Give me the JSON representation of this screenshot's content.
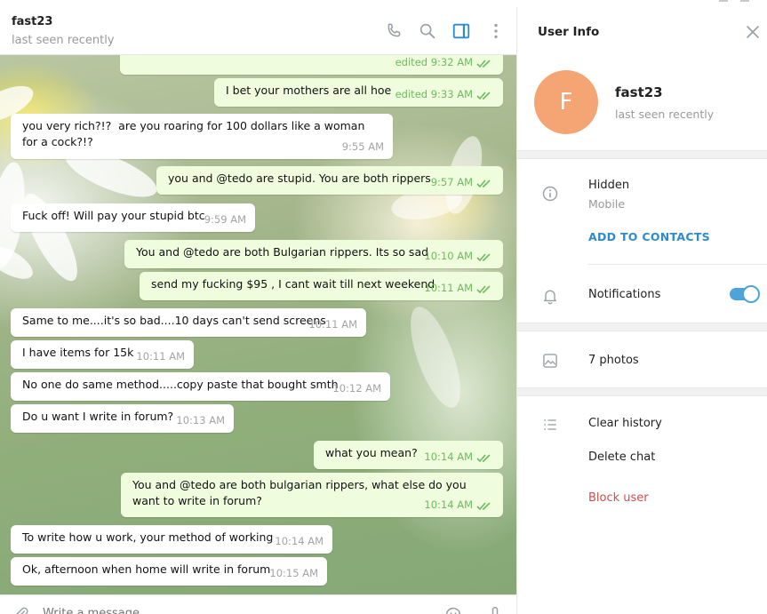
{
  "chat": {
    "title": "fast23",
    "subtitle": "last seen recently",
    "composer_placeholder": "Write a message...",
    "messages": [
      {
        "dir": "out",
        "text": "",
        "time": "edited 9:32 AM"
      },
      {
        "dir": "out",
        "text": "I bet your mothers are all hoe",
        "time": "edited 9:33 AM"
      },
      {
        "dir": "in",
        "text": "you very rich?!?  are you roaring for 100 dollars like a woman for a cock?!?",
        "time": "9:55 AM"
      },
      {
        "dir": "out",
        "text": "you and @tedo are stupid. You are both rippers",
        "time": "9:57 AM"
      },
      {
        "dir": "in",
        "text": "Fuck off! Will pay your stupid btc",
        "time": "9:59 AM"
      },
      {
        "dir": "out",
        "text": "You and @tedo are both Bulgarian rippers. Its so sad",
        "time": "10:10 AM"
      },
      {
        "dir": "out",
        "text": "send my fucking $95 , I cant wait till next weekend",
        "time": "10:11 AM"
      },
      {
        "dir": "in",
        "text": "Same to me....it's so bad....10 days can't send screens",
        "time": "10:11 AM"
      },
      {
        "dir": "in",
        "text": "I have items for 15k",
        "time": "10:11 AM"
      },
      {
        "dir": "in",
        "text": "No one do same method.....copy paste that bought smth",
        "time": "10:12 AM"
      },
      {
        "dir": "in",
        "text": "Do u want I write in forum?",
        "time": "10:13 AM"
      },
      {
        "dir": "out",
        "text": "what you mean?",
        "time": "10:14 AM"
      },
      {
        "dir": "out",
        "text": "You and @tedo are both bulgarian rippers, what else do you want to write in forum?",
        "time": "10:14 AM"
      },
      {
        "dir": "in",
        "text": "To write how u work, your method of working",
        "time": "10:14 AM"
      },
      {
        "dir": "in",
        "text": "Ok, afternoon when home will write in forum",
        "time": "10:15 AM"
      }
    ]
  },
  "info": {
    "title": "User Info",
    "avatar_letter": "F",
    "avatar_color": "#f5a474",
    "name": "fast23",
    "status": "last seen recently",
    "phone_label": "Hidden",
    "phone_sub": "Mobile",
    "add_contact": "ADD TO CONTACTS",
    "notifications": "Notifications",
    "notifications_on": true,
    "photos": "7 photos",
    "clear_history": "Clear history",
    "delete_chat": "Delete chat",
    "block_user": "Block user"
  },
  "colors": {
    "accent": "#2c8bd1",
    "outgoing_bubble": "#effdde",
    "outgoing_time": "#6cbb5c",
    "danger": "#d14e4e"
  },
  "icons": [
    "phone-icon",
    "search-icon",
    "sidebar-toggle-icon",
    "more-vertical-icon",
    "close-icon",
    "info-icon",
    "bell-icon",
    "photo-icon",
    "list-icon",
    "attach-icon",
    "emoji-icon",
    "microphone-icon",
    "double-check-icon"
  ]
}
